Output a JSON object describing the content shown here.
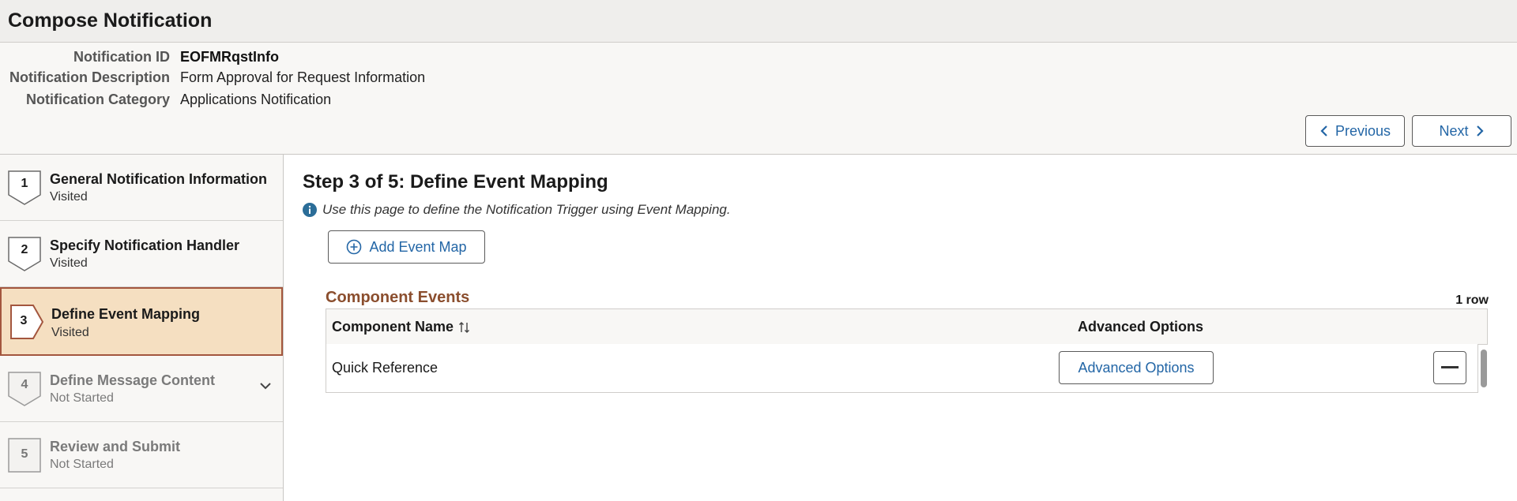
{
  "page": {
    "title": "Compose Notification"
  },
  "notification": {
    "id_label": "Notification ID",
    "id_value": "EOFMRqstInfo",
    "description_label": "Notification Description",
    "description_value": "Form Approval for Request Information",
    "category_label": "Notification Category",
    "category_value": "Applications Notification"
  },
  "navigation": {
    "previous_label": "Previous",
    "next_label": "Next"
  },
  "steps": [
    {
      "number": "1",
      "title": "General Notification Information",
      "status": "Visited"
    },
    {
      "number": "2",
      "title": "Specify Notification Handler",
      "status": "Visited"
    },
    {
      "number": "3",
      "title": "Define Event Mapping",
      "status": "Visited"
    },
    {
      "number": "4",
      "title": "Define Message Content",
      "status": "Not Started"
    },
    {
      "number": "5",
      "title": "Review and Submit",
      "status": "Not Started"
    }
  ],
  "main": {
    "step_title": "Step 3 of 5: Define Event Mapping",
    "info_text": "Use this page to define the Notification Trigger using Event Mapping.",
    "add_button_label": "Add Event Map"
  },
  "component_events": {
    "title": "Component Events",
    "row_count": "1 row",
    "columns": [
      "Component Name",
      "Advanced Options"
    ],
    "rows": [
      {
        "component_name": "Quick Reference",
        "advanced_options_label": "Advanced Options"
      }
    ]
  },
  "colors": {
    "accent_link": "#2366a6",
    "active_step_bg": "#f5dfc1",
    "active_step_border": "#a3563e",
    "section_title": "#8b4e2e",
    "info_icon": "#2b6d98"
  },
  "icons": {
    "previous": "chevron-left-icon",
    "next": "chevron-right-icon",
    "info": "info-icon",
    "add": "plus-circle-icon",
    "sort": "sort-icon",
    "expand_step_4": "chevron-down-icon",
    "delete_row": "minus-icon"
  }
}
